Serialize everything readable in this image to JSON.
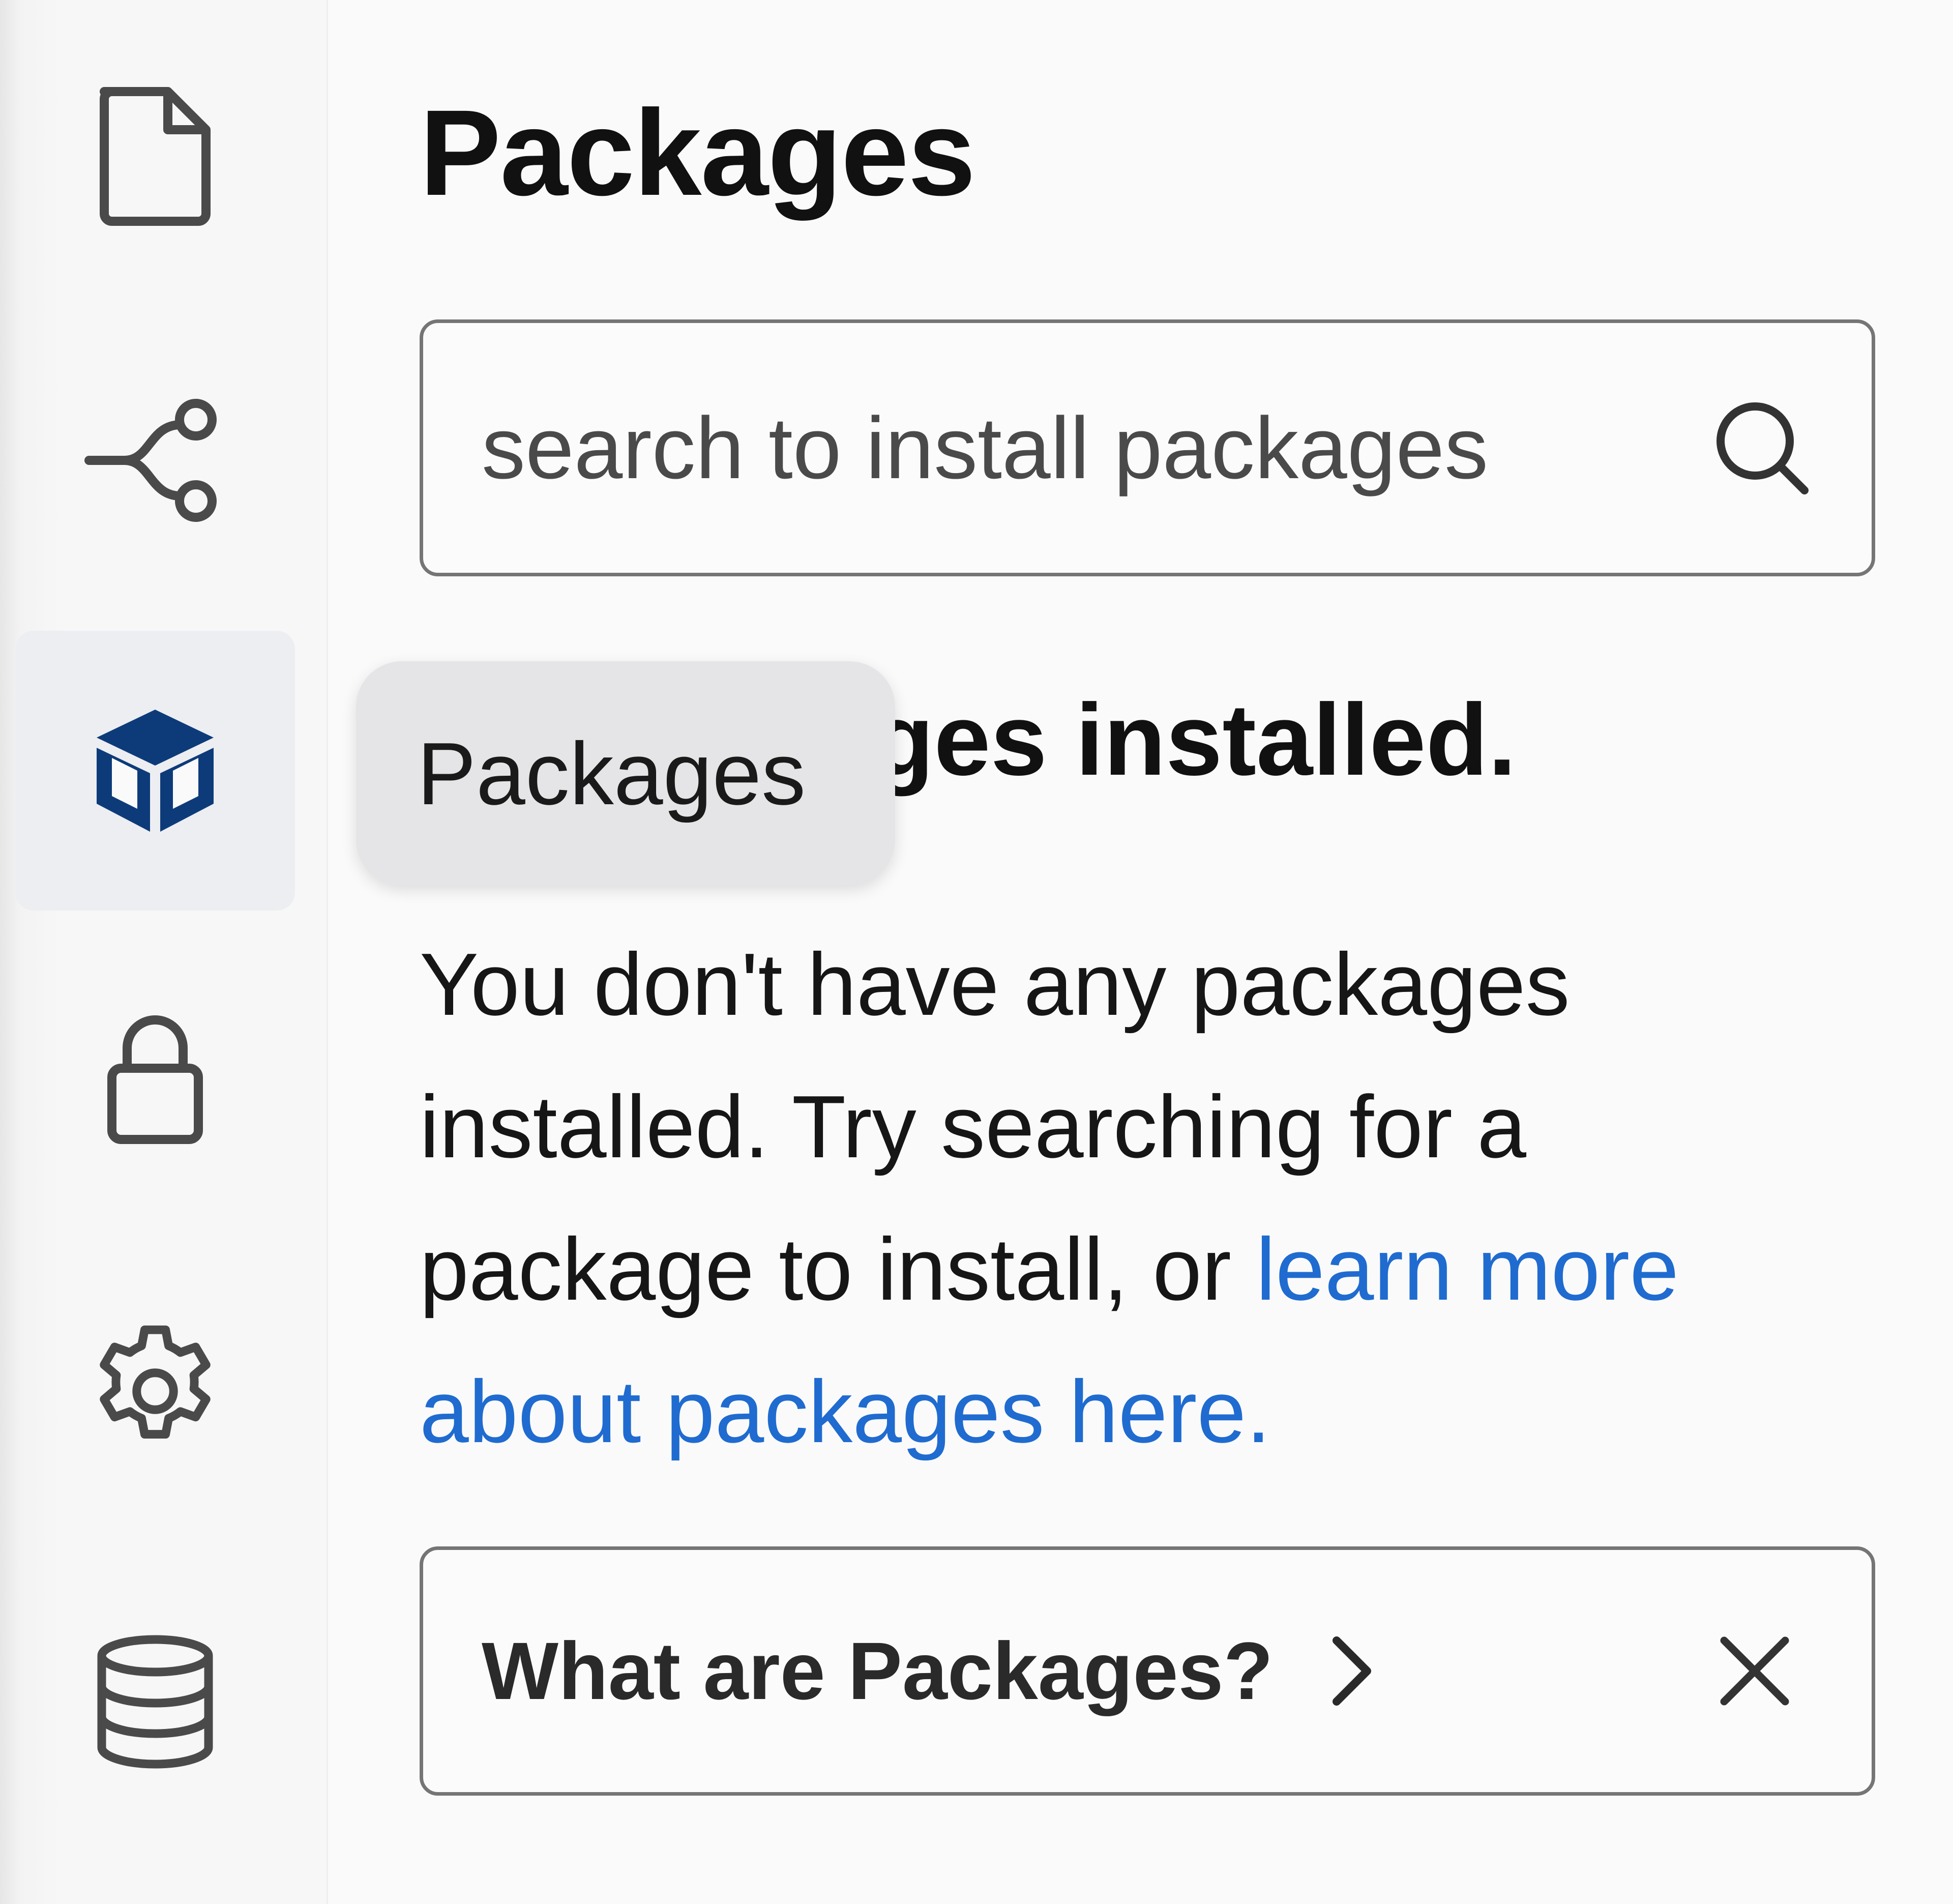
{
  "sidebar": {
    "items": [
      {
        "id": "files",
        "icon": "file-icon",
        "active": false
      },
      {
        "id": "git",
        "icon": "git-branch-icon",
        "active": false
      },
      {
        "id": "packages",
        "icon": "package-cube-icon",
        "active": true,
        "tooltip": "Packages"
      },
      {
        "id": "secrets",
        "icon": "lock-icon",
        "active": false
      },
      {
        "id": "settings",
        "icon": "gear-icon",
        "active": false
      },
      {
        "id": "database",
        "icon": "database-icon",
        "active": false
      }
    ]
  },
  "main": {
    "title": "Packages",
    "search": {
      "placeholder": "search to install packages",
      "value": "",
      "icon": "search-icon"
    },
    "empty_state": {
      "heading": "No packages installed.",
      "description": "You don't have any packages installed. Try searching for a package to install, or ",
      "link_text": "learn more about packages here."
    },
    "info_card": {
      "label": "What are Packages?",
      "chevron_icon": "chevron-right-icon",
      "close_icon": "close-icon"
    }
  },
  "colors": {
    "active_icon": "#0d3b7a",
    "link": "#1f6bd0",
    "icon": "#4a4a4a",
    "border": "#757575"
  }
}
